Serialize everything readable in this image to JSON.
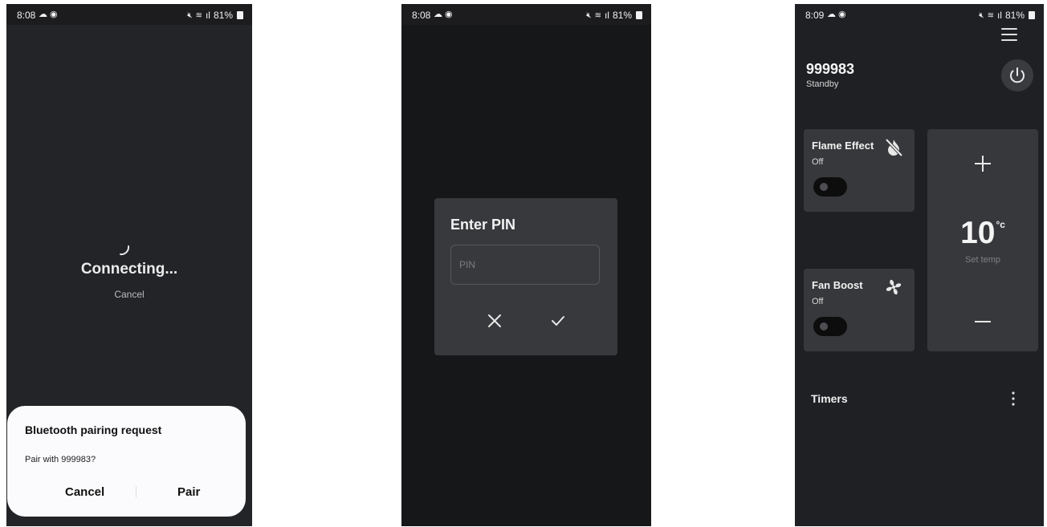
{
  "screens": {
    "connecting": {
      "status_bar": {
        "time": "8:08",
        "battery": "81%"
      },
      "title": "Connecting...",
      "cancel_label": "Cancel",
      "pair_dialog": {
        "title": "Bluetooth pairing request",
        "message": "Pair with 999983?",
        "cancel_label": "Cancel",
        "pair_label": "Pair"
      }
    },
    "pin": {
      "status_bar": {
        "time": "8:08",
        "battery": "81%"
      },
      "dialog": {
        "title": "Enter PIN",
        "placeholder": "PIN",
        "cancel_icon": "close-icon",
        "confirm_icon": "check-icon"
      }
    },
    "control": {
      "status_bar": {
        "time": "8:09",
        "battery": "81%"
      },
      "device_name": "999983",
      "device_status": "Standby",
      "flame_effect": {
        "label": "Flame Effect",
        "state": "Off",
        "icon": "flame-off-icon",
        "on": false
      },
      "fan_boost": {
        "label": "Fan Boost",
        "state": "Off",
        "icon": "fan-icon",
        "on": false
      },
      "set_temp": {
        "value": "10",
        "unit": "°c",
        "label": "Set temp"
      },
      "timers_label": "Timers"
    }
  },
  "colors": {
    "panel": "#37383b",
    "toggle_off": "#0d0d0d",
    "sheet": "#fbfbfd"
  }
}
